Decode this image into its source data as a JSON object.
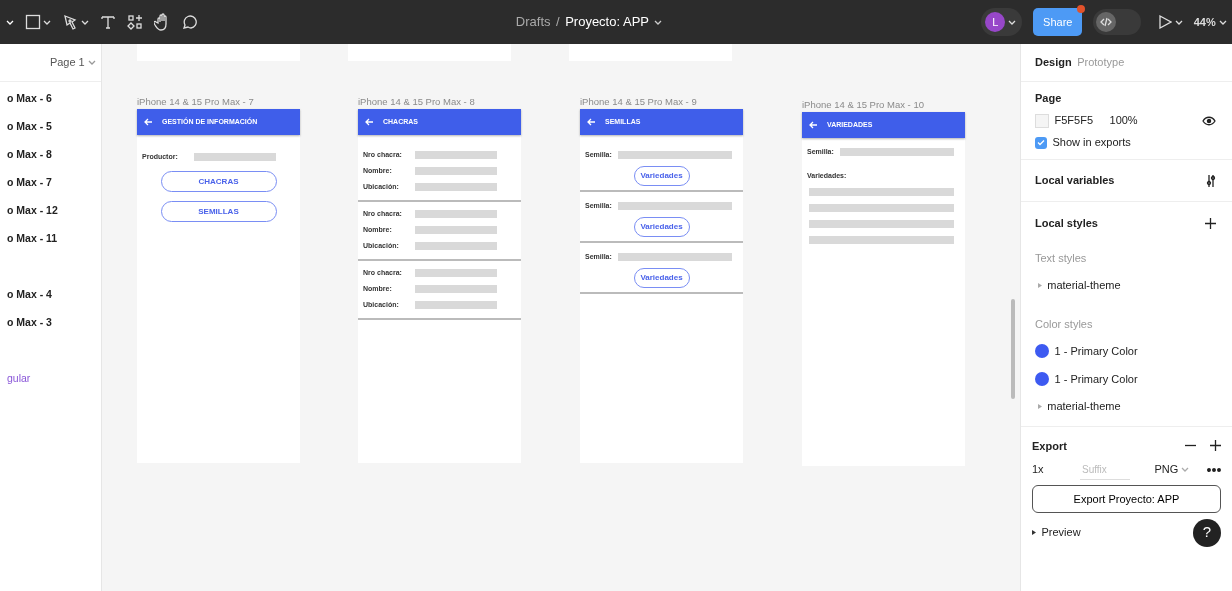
{
  "breadcrumb": {
    "parent": "Drafts",
    "separator": "/",
    "file": "Proyecto: APP"
  },
  "toolbar": {
    "avatar": "L",
    "share": "Share",
    "share_notification": true,
    "dev_mode": false,
    "zoom": "44%"
  },
  "left_panel": {
    "page": "Page 1",
    "layer_groups": [
      {
        "layers": [
          {
            "label": "o Max - 6",
            "kind": "frame"
          },
          {
            "label": "o Max - 5",
            "kind": "frame"
          },
          {
            "label": "o Max - 8",
            "kind": "frame"
          },
          {
            "label": "o Max - 7",
            "kind": "frame"
          },
          {
            "label": "o Max - 12",
            "kind": "frame"
          },
          {
            "label": "o Max - 11",
            "kind": "frame"
          }
        ]
      },
      {
        "layers": [
          {
            "label": "o Max - 4",
            "kind": "frame"
          },
          {
            "label": "o Max - 3",
            "kind": "frame"
          }
        ]
      },
      {
        "layers": [
          {
            "label": "gular",
            "kind": "component"
          }
        ]
      }
    ]
  },
  "frames": [
    {
      "label": "iPhone 14 & 15 Pro Max - 7",
      "title": "GESTIÓN DE INFORMACIÓN",
      "blocks": [
        {
          "kind": "field",
          "label": "Productor:"
        },
        {
          "kind": "button",
          "label": "CHACRAS"
        },
        {
          "kind": "button",
          "label": "SEMILLAS"
        }
      ]
    },
    {
      "label": "iPhone 14 & 15 Pro Max - 8",
      "title": "CHACRAS",
      "blocks": [
        {
          "kind": "field",
          "label": "Nro chacra:"
        },
        {
          "kind": "field",
          "label": "Nombre:"
        },
        {
          "kind": "field",
          "label": "Ubicación:"
        },
        {
          "kind": "divider"
        },
        {
          "kind": "field",
          "label": "Nro chacra:"
        },
        {
          "kind": "field",
          "label": "Nombre:"
        },
        {
          "kind": "field",
          "label": "Ubicación:"
        },
        {
          "kind": "divider"
        },
        {
          "kind": "field",
          "label": "Nro chacra:"
        },
        {
          "kind": "field",
          "label": "Nombre:"
        },
        {
          "kind": "field",
          "label": "Ubicación:"
        },
        {
          "kind": "divider"
        }
      ]
    },
    {
      "label": "iPhone 14 & 15 Pro Max - 9",
      "title": "SEMILLAS",
      "blocks": [
        {
          "kind": "field",
          "label": "Semilla:"
        },
        {
          "kind": "pill",
          "label": "Variedades"
        },
        {
          "kind": "divider"
        },
        {
          "kind": "field",
          "label": "Semilla:"
        },
        {
          "kind": "pill",
          "label": "Variedades"
        },
        {
          "kind": "divider"
        },
        {
          "kind": "field",
          "label": "Semilla:"
        },
        {
          "kind": "pill",
          "label": "Variedades"
        },
        {
          "kind": "divider"
        }
      ]
    },
    {
      "label": "iPhone 14 & 15 Pro Max - 10",
      "title": "VARIEDADES",
      "blocks": [
        {
          "kind": "field",
          "label": "Semilla:"
        },
        {
          "kind": "heading",
          "label": "Variedades:"
        },
        {
          "kind": "bar"
        },
        {
          "kind": "bar"
        },
        {
          "kind": "bar"
        },
        {
          "kind": "bar"
        }
      ]
    }
  ],
  "right_panel": {
    "tabs": [
      {
        "label": "Design",
        "selected": true
      },
      {
        "label": "Prototype",
        "selected": false
      }
    ],
    "page": {
      "title": "Page",
      "color": "F5F5F5",
      "opacity": "100%",
      "visible": true,
      "show_in_exports": "Show in exports",
      "checked": true
    },
    "local_variables": "Local variables",
    "local_styles": {
      "title": "Local styles",
      "text_styles": "Text styles",
      "text_items": [
        "material-theme"
      ],
      "color_styles": "Color styles",
      "colors": [
        {
          "name": "1 - Primary Color",
          "color": "#3d5af1"
        },
        {
          "name": "1 - Primary Color",
          "color": "#3d5af1"
        }
      ],
      "groups": [
        "material-theme"
      ]
    },
    "export": {
      "title": "Export",
      "scale": "1x",
      "suffix_placeholder": "Suffix",
      "format": "PNG",
      "button": "Export Proyecto: APP",
      "preview": "Preview"
    },
    "help": "?"
  }
}
